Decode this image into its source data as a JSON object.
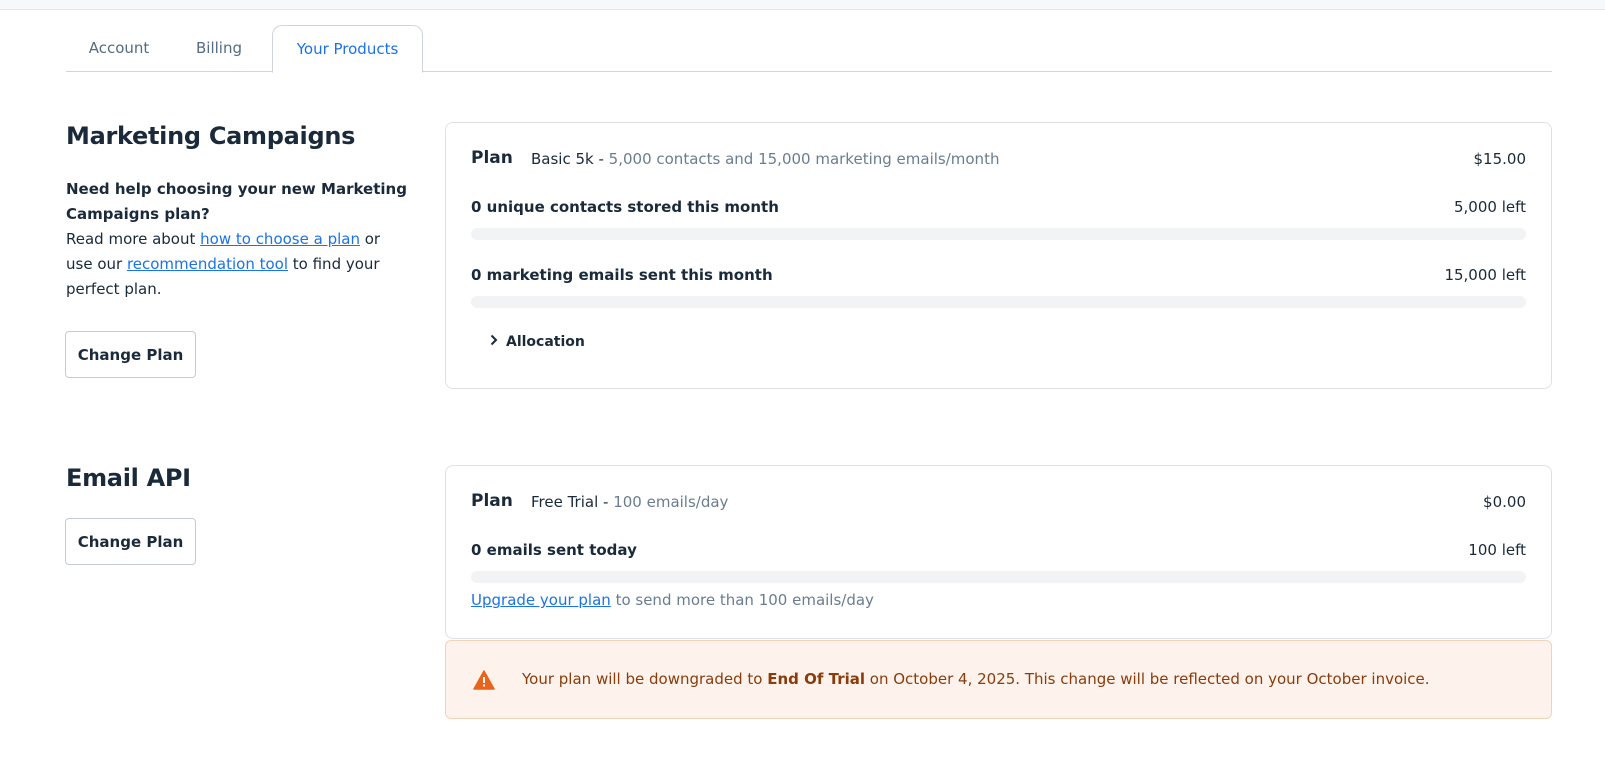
{
  "tabs": [
    {
      "label": "Account"
    },
    {
      "label": "Billing"
    },
    {
      "label": "Your Products",
      "active": true
    }
  ],
  "marketing": {
    "title": "Marketing Campaigns",
    "help_bold": "Need help choosing your new Marketing Campaigns plan?",
    "help_text_1": "Read more about ",
    "help_link_1": "how to choose a plan",
    "help_text_2": " or use our ",
    "help_link_2": "recommendation tool",
    "help_text_3": " to find your perfect plan.",
    "change_plan_label": "Change Plan",
    "plan": {
      "label": "Plan",
      "name": "Basic 5k - ",
      "description": "5,000 contacts and 15,000 marketing emails/month",
      "price": "$15.00"
    },
    "metrics": [
      {
        "label": "0 unique contacts stored this month",
        "left": "5,000 left",
        "usage_fraction": 0
      },
      {
        "label": "0 marketing emails sent this month",
        "left": "15,000 left",
        "usage_fraction": 0
      }
    ],
    "allocation_label": "Allocation"
  },
  "email_api": {
    "title": "Email API",
    "change_plan_label": "Change Plan",
    "plan": {
      "label": "Plan",
      "name": "Free Trial - ",
      "description": "100 emails/day",
      "price": "$0.00"
    },
    "metrics": [
      {
        "label": "0 emails sent today",
        "left": "100 left",
        "usage_fraction": 0
      }
    ],
    "upgrade_link": "Upgrade your plan",
    "upgrade_text": " to send more than 100 emails/day"
  },
  "alert": {
    "icon": "warning-icon",
    "text_1": "Your plan will be downgraded to ",
    "bold": "End Of Trial",
    "text_2": " on October 4, 2025. This change will be reflected on your October invoice.",
    "color": "#e8641c"
  }
}
